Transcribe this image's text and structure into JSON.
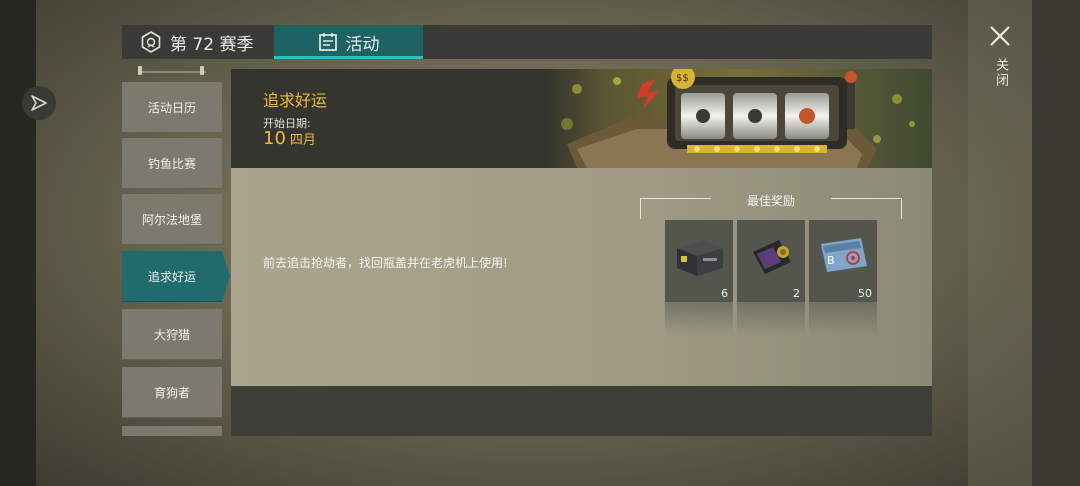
{
  "tabs": [
    {
      "label": "第 72 赛季",
      "icon": "season-badge-icon"
    },
    {
      "label": "活动",
      "icon": "calendar-icon",
      "active": true
    }
  ],
  "sidebar": {
    "items": [
      {
        "label": "活动日历"
      },
      {
        "label": "钓鱼比赛"
      },
      {
        "label": "阿尔法地堡"
      },
      {
        "label": "追求好运",
        "active": true
      },
      {
        "label": "大狩猎"
      },
      {
        "label": "育狗者"
      }
    ]
  },
  "event": {
    "title": "追求好运",
    "start_label": "开始日期:",
    "start_day": "10",
    "start_month": "四月",
    "description": "前去追击抢劫者，找回瓶盖并在老虎机上使用!"
  },
  "rewards": {
    "title": "最佳奖励",
    "items": [
      {
        "icon": "weapon-crate-icon",
        "count": "6"
      },
      {
        "icon": "id-badge-icon",
        "count": "2"
      },
      {
        "icon": "biohazard-keycard-icon",
        "count": "50"
      }
    ]
  },
  "close": {
    "label": "关闭"
  },
  "colors": {
    "accent": "#1f6b6e",
    "highlight": "#f3b63a"
  }
}
